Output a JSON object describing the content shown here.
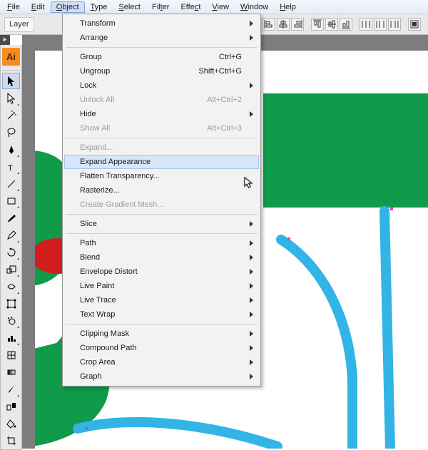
{
  "menubar": {
    "items": [
      {
        "label": "File",
        "u": 0
      },
      {
        "label": "Edit",
        "u": 0
      },
      {
        "label": "Object",
        "u": 0
      },
      {
        "label": "Type",
        "u": 0
      },
      {
        "label": "Select",
        "u": 0
      },
      {
        "label": "Filter",
        "u": 3
      },
      {
        "label": "Effect",
        "u": 4
      },
      {
        "label": "View",
        "u": 0
      },
      {
        "label": "Window",
        "u": 0
      },
      {
        "label": "Help",
        "u": 0
      }
    ],
    "open_index": 2
  },
  "optionsbar": {
    "layer_label": "Layer"
  },
  "toolbox": {
    "logo": "Ai",
    "tools": [
      {
        "name": "selection-tool",
        "icon": "arrow",
        "sel": true,
        "tri": false
      },
      {
        "name": "direct-selection-tool",
        "icon": "whitearrow",
        "tri": true
      },
      {
        "name": "magic-wand-tool",
        "icon": "wand",
        "tri": false
      },
      {
        "name": "lasso-tool",
        "icon": "lasso",
        "tri": false
      },
      {
        "name": "pen-tool",
        "icon": "pen",
        "tri": true
      },
      {
        "name": "type-tool",
        "icon": "type",
        "tri": true
      },
      {
        "name": "line-segment-tool",
        "icon": "line",
        "tri": true
      },
      {
        "name": "rectangle-tool",
        "icon": "rect",
        "tri": true
      },
      {
        "name": "paintbrush-tool",
        "icon": "brush",
        "tri": false
      },
      {
        "name": "pencil-tool",
        "icon": "pencil",
        "tri": true
      },
      {
        "name": "rotate-tool",
        "icon": "rotate",
        "tri": true
      },
      {
        "name": "scale-tool",
        "icon": "scale",
        "tri": true
      },
      {
        "name": "warp-tool",
        "icon": "warp",
        "tri": true
      },
      {
        "name": "free-transform-tool",
        "icon": "freetrans",
        "tri": false
      },
      {
        "name": "symbol-sprayer-tool",
        "icon": "spray",
        "tri": true
      },
      {
        "name": "column-graph-tool",
        "icon": "graph",
        "tri": true
      },
      {
        "name": "mesh-tool",
        "icon": "mesh",
        "tri": false
      },
      {
        "name": "gradient-tool",
        "icon": "grad",
        "tri": false
      },
      {
        "name": "eyedropper-tool",
        "icon": "eye",
        "tri": true
      },
      {
        "name": "blend-tool",
        "icon": "blend",
        "tri": false
      },
      {
        "name": "live-paint-bucket-tool",
        "icon": "bucket",
        "tri": false
      },
      {
        "name": "crop-area-tool",
        "icon": "crop",
        "tri": false
      }
    ]
  },
  "object_menu": {
    "groups": [
      [
        {
          "label": "Transform",
          "sub": true
        },
        {
          "label": "Arrange",
          "sub": true
        }
      ],
      [
        {
          "label": "Group",
          "shortcut": "Ctrl+G"
        },
        {
          "label": "Ungroup",
          "shortcut": "Shift+Ctrl+G"
        },
        {
          "label": "Lock",
          "sub": true
        },
        {
          "label": "Unlock All",
          "shortcut": "Alt+Ctrl+2",
          "disabled": true
        },
        {
          "label": "Hide",
          "sub": true
        },
        {
          "label": "Show All",
          "shortcut": "Alt+Ctrl+3",
          "disabled": true
        }
      ],
      [
        {
          "label": "Expand...",
          "disabled": true
        },
        {
          "label": "Expand Appearance",
          "highlight": true
        },
        {
          "label": "Flatten Transparency..."
        },
        {
          "label": "Rasterize..."
        },
        {
          "label": "Create Gradient Mesh...",
          "disabled": true
        }
      ],
      [
        {
          "label": "Slice",
          "sub": true
        }
      ],
      [
        {
          "label": "Path",
          "sub": true
        },
        {
          "label": "Blend",
          "sub": true
        },
        {
          "label": "Envelope Distort",
          "sub": true
        },
        {
          "label": "Live Paint",
          "sub": true
        },
        {
          "label": "Live Trace",
          "sub": true
        },
        {
          "label": "Text Wrap",
          "sub": true
        }
      ],
      [
        {
          "label": "Clipping Mask",
          "sub": true
        },
        {
          "label": "Compound Path",
          "sub": true
        },
        {
          "label": "Crop Area",
          "sub": true
        },
        {
          "label": "Graph",
          "sub": true
        }
      ]
    ]
  },
  "colors": {
    "green": "#109b4a",
    "blue": "#32b4e6",
    "red": "#d21e1e",
    "anchor": "#e83fbe"
  }
}
